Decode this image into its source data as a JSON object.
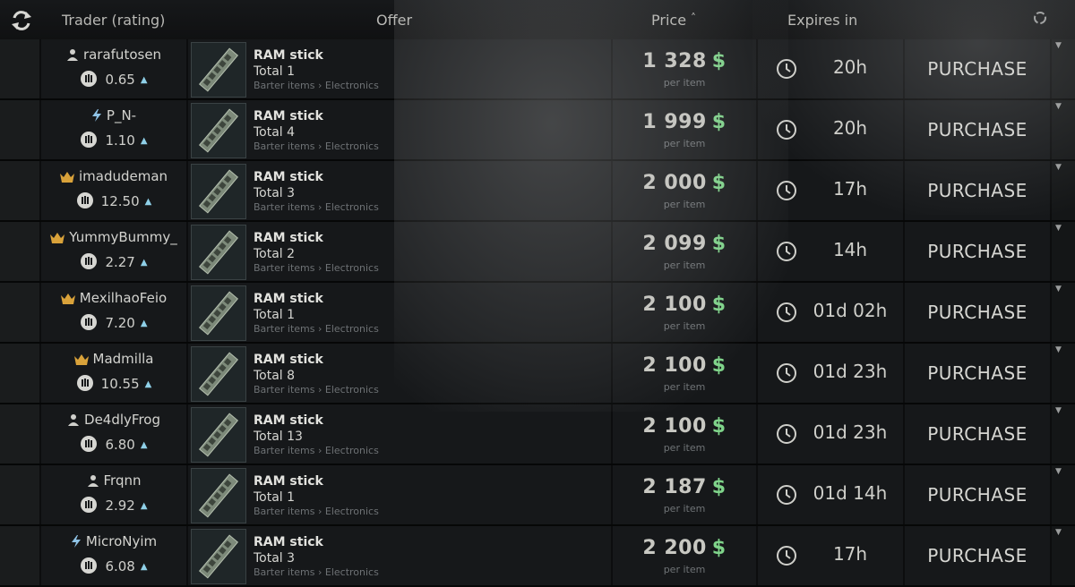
{
  "header": {
    "trader_label": "Trader (rating)",
    "offer_label": "Offer",
    "price_label": "Price",
    "price_sort": "˄",
    "expires_label": "Expires in"
  },
  "common": {
    "currency": "$",
    "per_item": "per item",
    "purchase": "PURCHASE",
    "item_name": "RAM stick",
    "category": "Barter items › Electronics"
  },
  "colors": {
    "currency_green": "#7fd48a",
    "rep_arrow": "#8fd0e8",
    "crown": "#d9a23a"
  },
  "offers": [
    {
      "trader": "rarafutosen",
      "trader_icon": "person-icon",
      "rating": "0.65",
      "total": "Total 1",
      "price": "1 328",
      "expires": "20h"
    },
    {
      "trader": "P_N-",
      "trader_icon": "lightning-icon",
      "rating": "1.10",
      "total": "Total 4",
      "price": "1 999",
      "expires": "20h"
    },
    {
      "trader": "imadudeman",
      "trader_icon": "crown-icon",
      "rating": "12.50",
      "total": "Total 3",
      "price": "2 000",
      "expires": "17h"
    },
    {
      "trader": "YummyBummy_",
      "trader_icon": "crown-icon",
      "rating": "2.27",
      "total": "Total 2",
      "price": "2 099",
      "expires": "14h"
    },
    {
      "trader": "MexilhaoFeio",
      "trader_icon": "crown-icon",
      "rating": "7.20",
      "total": "Total 1",
      "price": "2 100",
      "expires": "01d 02h"
    },
    {
      "trader": "Madmilla",
      "trader_icon": "crown-icon",
      "rating": "10.55",
      "total": "Total 8",
      "price": "2 100",
      "expires": "01d 23h"
    },
    {
      "trader": "De4dlyFrog",
      "trader_icon": "person-icon",
      "rating": "6.80",
      "total": "Total 13",
      "price": "2 100",
      "expires": "01d 23h"
    },
    {
      "trader": "Frqnn",
      "trader_icon": "person-icon",
      "rating": "2.92",
      "total": "Total 1",
      "price": "2 187",
      "expires": "01d 14h"
    },
    {
      "trader": "MicroNyim",
      "trader_icon": "lightning-icon",
      "rating": "6.08",
      "total": "Total 3",
      "price": "2 200",
      "expires": "17h"
    }
  ]
}
